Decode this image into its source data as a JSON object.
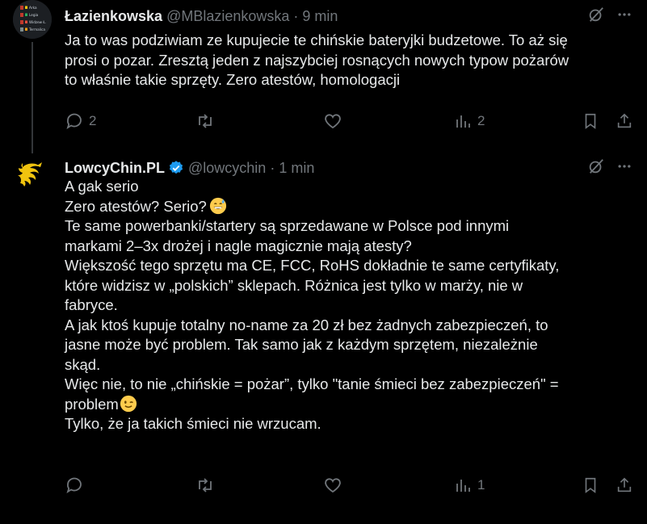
{
  "colors": {
    "background": "#000000",
    "text": "#e7e9ea",
    "secondary": "#71767b",
    "verified": "#1d9bf0",
    "thread_line": "#333639"
  },
  "tweets": [
    {
      "name": "Łazienkowska",
      "handle": "@MBlazienkowska",
      "separator": "·",
      "time": "9 min",
      "verified": false,
      "avatar": "league-table-avatar",
      "avatar_rows": [
        "Arka",
        "Legia",
        "Widzew Ł.",
        "Termalica"
      ],
      "lines": [
        "Ja to was podziwiam ze kupujecie te chińskie bateryjki budzetowe. To aż się",
        "prosi o pozar. Zresztą jeden z najszybciej rosnących nowych typow pożarów",
        "to właśnie takie sprzęty. Zero atestów, homologacji"
      ],
      "actions": {
        "reply_count": "2",
        "repost_count": "",
        "like_count": "",
        "views_count": "2"
      }
    },
    {
      "name": "LowcyChin.PL",
      "handle": "@lowcychin",
      "separator": "·",
      "time": "1 min",
      "verified": true,
      "avatar": "yellow-dragon-logo-avatar",
      "lines": [
        "A gak serio",
        "Zero atestów? Serio?",
        "Te same powerbanki/startery są sprzedawane w Polsce pod innymi",
        "markami 2–3x drożej i nagle magicznie mają atesty?",
        "Większość tego sprzętu ma CE, FCC, RoHS  dokładnie te same certyfikaty,",
        "które widzisz w „polskich” sklepach. Różnica jest tylko w marży, nie w",
        "fabryce.",
        "A jak ktoś kupuje totalny no-name za 20 zł bez żadnych zabezpieczeń, to",
        "jasne  może być problem. Tak samo jak z każdym sprzętem, niezależnie",
        "skąd.",
        "Więc nie, to nie „chińskie = pożar”, tylko \"tanie śmieci bez zabezpieczeń\" =",
        "problem",
        "Tylko, że ja takich śmieci nie wrzucam."
      ],
      "emojis": {
        "line_2": "grinning-face-with-sweat-emoji",
        "line_12": "winking-face-emoji"
      },
      "actions": {
        "reply_count": "",
        "repost_count": "",
        "like_count": "",
        "views_count": "1"
      }
    }
  ]
}
